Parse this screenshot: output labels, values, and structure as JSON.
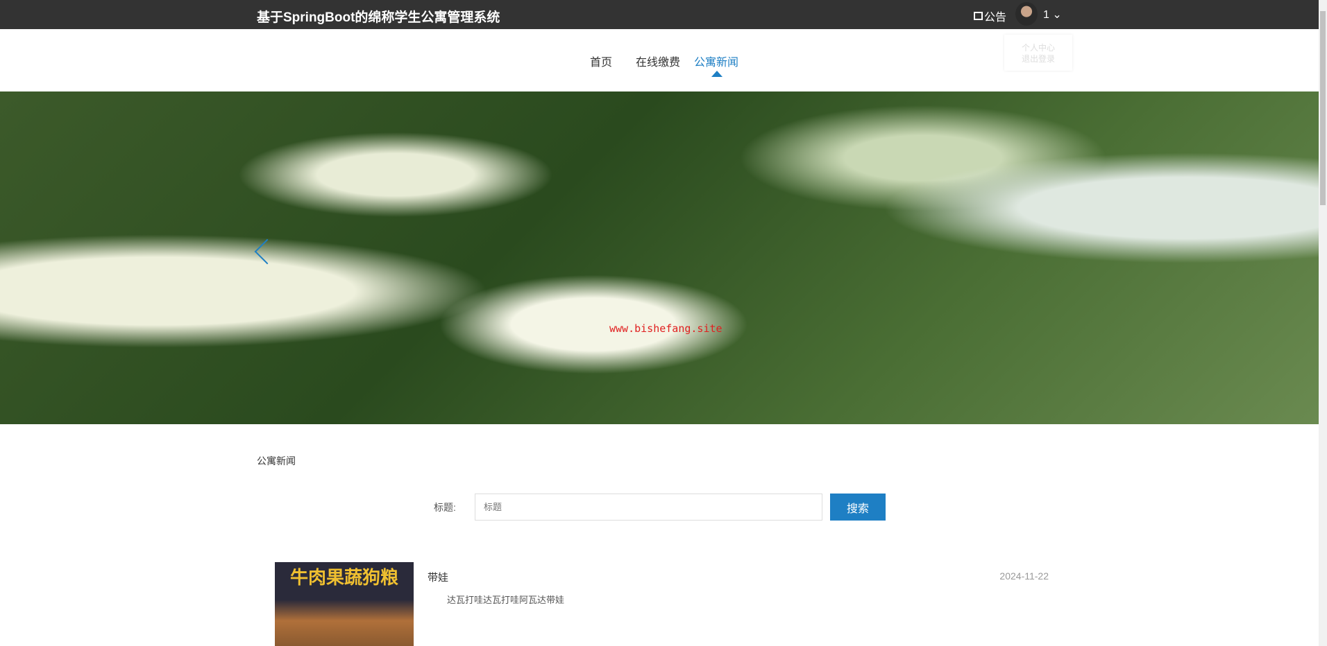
{
  "header": {
    "title": "基于SpringBoot的绵称学生公寓管理系统",
    "notice": "公告",
    "username": "1",
    "chevron": "⌄"
  },
  "user_menu": {
    "items": [
      "个人中心",
      "退出登录"
    ]
  },
  "nav": {
    "items": [
      "首页",
      "在线缴费",
      "公寓新闻"
    ],
    "active": "公寓新闻"
  },
  "banner": {
    "watermark": "www.bishefang.site"
  },
  "breadcrumb": "公寓新闻",
  "search": {
    "label": "标题:",
    "placeholder": "标题",
    "value": "",
    "button": "搜索"
  },
  "news": [
    {
      "title": "带娃",
      "date": "2024-11-22",
      "summary": "达瓦打哇达瓦打哇阿瓦达带娃",
      "image_text": "牛肉果蔬狗粮"
    }
  ],
  "colors": {
    "accent": "#1e7fc4",
    "topbar": "#333333"
  }
}
